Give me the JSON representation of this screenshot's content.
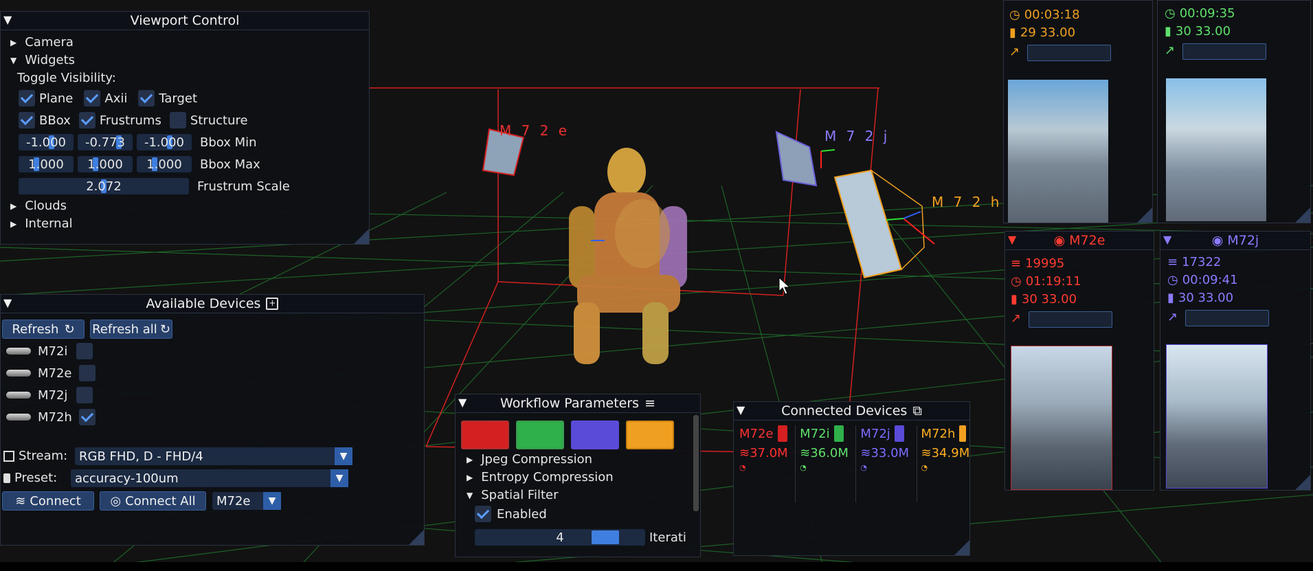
{
  "viewport_control": {
    "title": "Viewport Control",
    "camera": "Camera",
    "widgets": "Widgets",
    "toggle_visibility": "Toggle Visibility:",
    "plane": "Plane",
    "axii": "Axii",
    "target": "Target",
    "bbox": "BBox",
    "frustrums": "Frustrums",
    "structure": "Structure",
    "bbox_min": {
      "label": "Bbox Min",
      "values": [
        "-1.000",
        "-0.773",
        "-1.000"
      ]
    },
    "bbox_max": {
      "label": "Bbox Max",
      "values": [
        "1.000",
        "1.000",
        "1.000"
      ]
    },
    "frustrum_scale": {
      "label": "Frustrum Scale",
      "value": "2.072"
    },
    "clouds": "Clouds",
    "internal": "Internal"
  },
  "available_devices": {
    "title": "Available Devices",
    "refresh": "Refresh",
    "refresh_all": "Refresh all",
    "devices": [
      {
        "name": "M72i",
        "checked": false
      },
      {
        "name": "M72e",
        "checked": false
      },
      {
        "name": "M72j",
        "checked": false
      },
      {
        "name": "M72h",
        "checked": true
      }
    ],
    "stream_label": "Stream:",
    "stream_value": "RGB FHD, D - FHD/4",
    "preset_label": "Preset:",
    "preset_value": "accuracy-100um",
    "connect": "Connect",
    "connect_all": "Connect All",
    "connect_target": "M72e"
  },
  "workflow": {
    "title": "Workflow Parameters",
    "swatches": [
      "#d42020",
      "#2fb04a",
      "#5a4bd8",
      "#f0a020"
    ],
    "jpeg": "Jpeg Compression",
    "entropy": "Entropy Compression",
    "spatial": "Spatial Filter",
    "enabled": "Enabled",
    "iterations": {
      "value": "4",
      "label": "Iterati"
    }
  },
  "connected": {
    "title": "Connected Devices",
    "devices": [
      {
        "name": "M72e",
        "rate": "37.0M",
        "color": "#ff3030"
      },
      {
        "name": "M72i",
        "rate": "36.0M",
        "color": "#5fe06a"
      },
      {
        "name": "M72j",
        "rate": "33.0M",
        "color": "#7b6cff"
      },
      {
        "name": "M72h",
        "rate": "34.9M",
        "color": "#ffb020"
      }
    ]
  },
  "cards": {
    "top_left": {
      "time": "00:03:18",
      "fps": "29  33.00"
    },
    "top_right": {
      "time": "00:09:35",
      "fps": "30  33.00"
    },
    "m72e": {
      "title": "M72e",
      "count": "19995",
      "time": "01:19:11",
      "fps": "30  33.00",
      "color": "#ff3b30"
    },
    "m72j": {
      "title": "M72j",
      "count": "17322",
      "time": "00:09:41",
      "fps": "30  33.00",
      "color": "#8a7bff"
    }
  },
  "scene_labels": {
    "m72e": "M 7 2 e",
    "m72j": "M 7 2 j",
    "m72h": "M 7 2 h"
  },
  "colors": {
    "accent": "#3f7fe0",
    "panel": "#0e1014",
    "red": "#ff3030",
    "orange": "#f0a020"
  }
}
